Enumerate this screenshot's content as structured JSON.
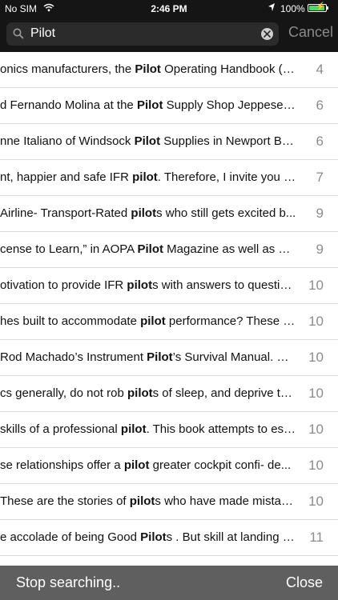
{
  "status_bar": {
    "carrier": "No SIM",
    "wifi_icon": "wifi-icon",
    "time": "2:46 PM",
    "location_icon": "location-arrow-icon",
    "battery_percent": "100%",
    "battery_icon": "battery-charging-icon",
    "battery_color": "#4cd964"
  },
  "search": {
    "query": "Pilot",
    "cancel_label": "Cancel",
    "search_icon": "search-icon",
    "clear_icon": "clear-icon"
  },
  "results": [
    {
      "pre": "onics manufacturers, the ",
      "match": "Pilot",
      "post": " Operating Handbook (P...",
      "page": "4"
    },
    {
      "pre": "d Fernando Molina at the ",
      "match": "Pilot",
      "post": " Supply Shop Jeppesen...",
      "page": "6"
    },
    {
      "pre": "nne Italiano of Windsock ",
      "match": "Pilot",
      "post": " Supplies in Newport Be...",
      "page": "6"
    },
    {
      "pre": "nt, happier and safe IFR ",
      "match": "pilot",
      "post": ". Therefore, I invite you to...",
      "page": "7"
    },
    {
      "pre": "Airline- Transport-Rated ",
      "match": "pilot",
      "post": "s who still gets excited b...",
      "page": "9"
    },
    {
      "pre": "cense to Learn,” in AOPA ",
      "match": "Pilot",
      "post": " Magazine as well as his...",
      "page": "9"
    },
    {
      "pre": "otivation to provide IFR ",
      "match": "pilot",
      "post": "s with answers to questio...",
      "page": "10"
    },
    {
      "pre": "hes built to accommodate ",
      "match": "pilot",
      "post": " performance? These q...",
      "page": "10"
    },
    {
      "pre": "Rod Machado’s Instrument ",
      "match": "Pilot",
      "post": "’s Survival Manual. Wi...",
      "page": "10"
    },
    {
      "pre": "cs generally, do not rob ",
      "match": "pilot",
      "post": "s of sleep, and deprive th...",
      "page": "10"
    },
    {
      "pre": "skills of a professional ",
      "match": "pilot",
      "post": ". This book attempts to est...",
      "page": "10"
    },
    {
      "pre": "se relationships offer a ",
      "match": "pilot",
      "post": " greater cockpit confi- de...",
      "page": "10"
    },
    {
      "pre": "These are the stories of ",
      "match": "pilot",
      "post": "s who have made mistak...",
      "page": "10"
    },
    {
      "pre": "e accolade of being Good ",
      "match": "Pilot",
      "post": "s . But skill at landing s...",
      "page": "11"
    }
  ],
  "bottom_bar": {
    "stop_label": "Stop searching..",
    "close_label": "Close"
  }
}
